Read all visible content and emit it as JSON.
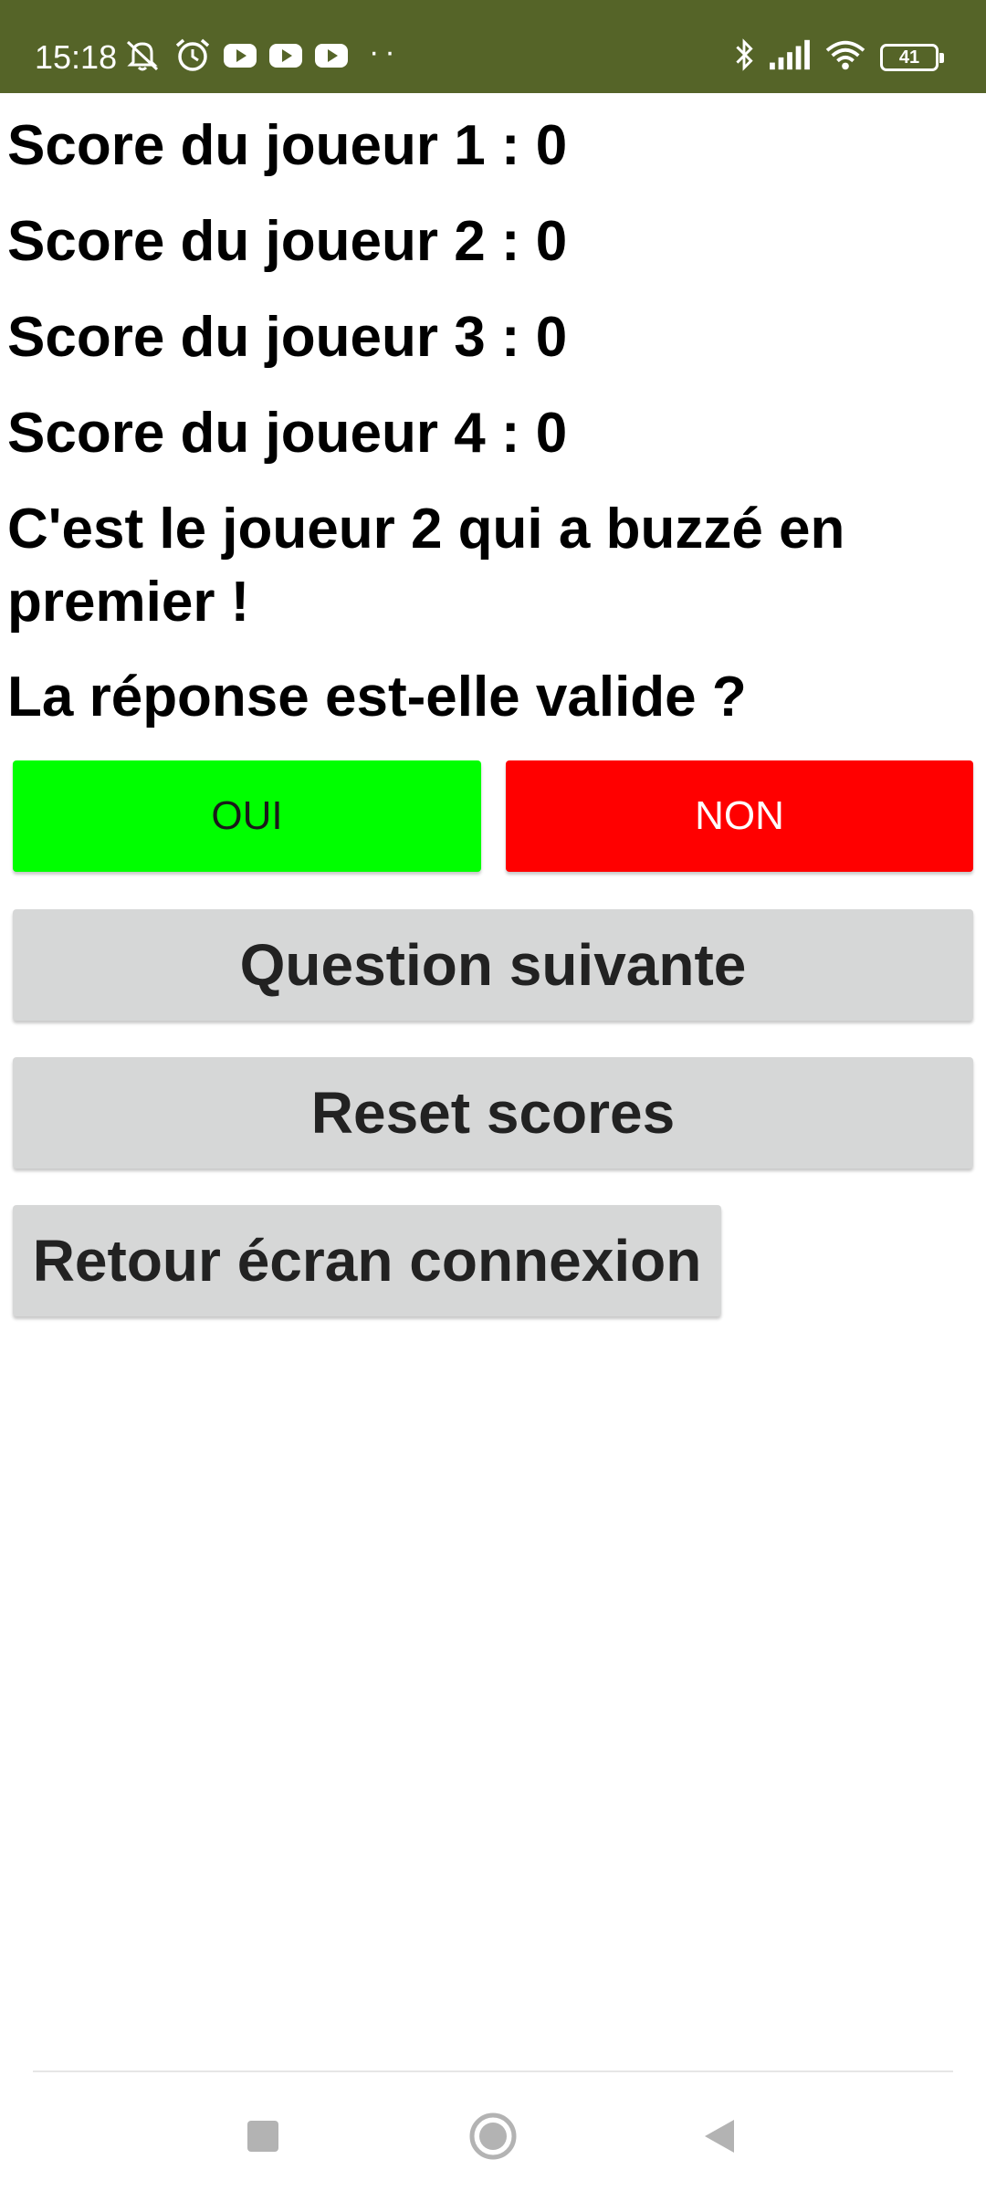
{
  "status_bar": {
    "time": "15:18",
    "dots": "··",
    "battery": "41",
    "icons": [
      "mute-notification-icon",
      "alarm-icon",
      "youtube-icon",
      "youtube-icon",
      "youtube-icon",
      "bluetooth-icon",
      "signal-icon",
      "wifi-icon",
      "battery-icon"
    ]
  },
  "scores": [
    "Score du joueur 1 : 0",
    "Score du joueur 2 : 0",
    "Score du joueur 3 : 0",
    "Score du joueur 4 : 0"
  ],
  "buzz_message": "C'est le joueur 2 qui a buzzé en premier !",
  "question": "La réponse est-elle valide ?",
  "buttons": {
    "oui": "OUI",
    "non": "NON",
    "next_question": "Question suivante",
    "reset_scores": "Reset scores",
    "back_to_login": "Retour écran connexion"
  },
  "colors": {
    "status_bar": "#556428",
    "oui": "#00ff00",
    "non": "#ff0000",
    "grey_button": "#d6d7d7"
  },
  "nav_bar": {
    "icons": [
      "recent-apps-icon",
      "home-icon",
      "back-icon"
    ]
  }
}
